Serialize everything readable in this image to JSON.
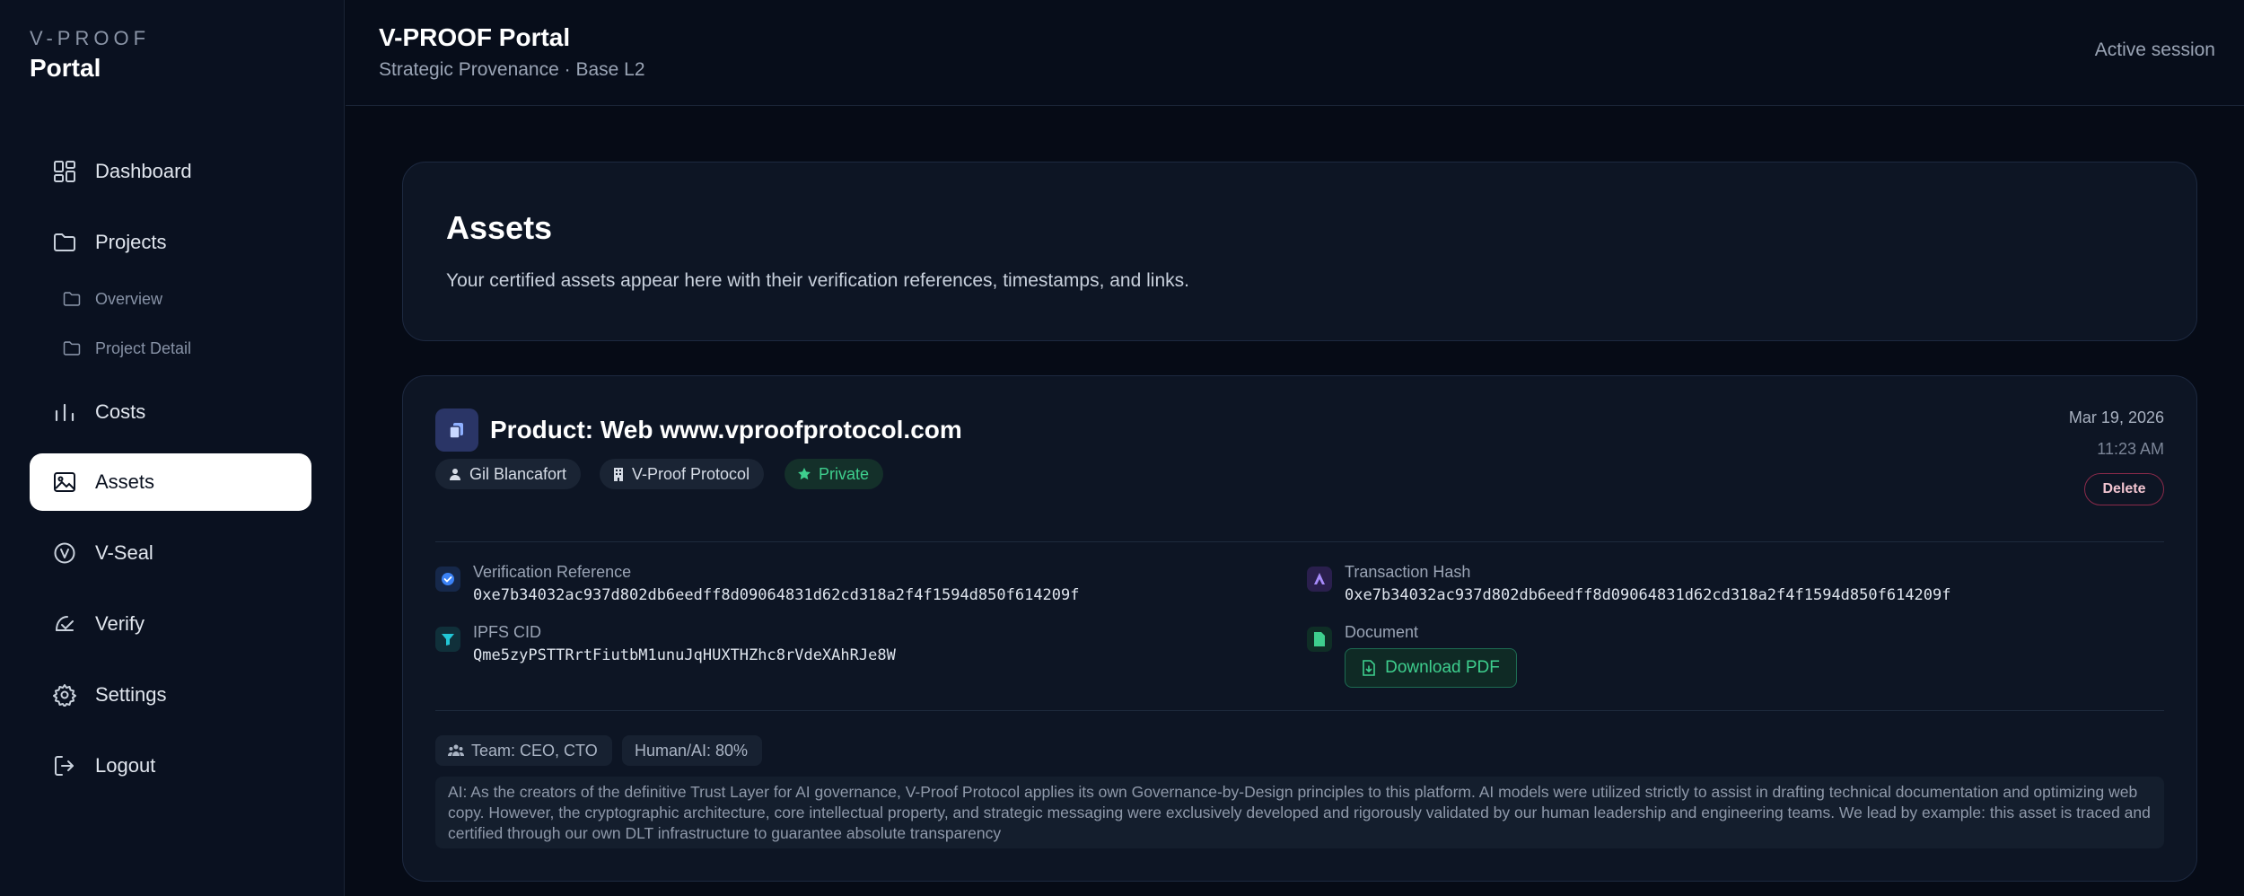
{
  "brand": {
    "small": "V-PROOF",
    "big": "Portal"
  },
  "nav": {
    "dashboard": "Dashboard",
    "projects": "Projects",
    "overview": "Overview",
    "project_detail": "Project Detail",
    "costs": "Costs",
    "assets": "Assets",
    "vseal": "V-Seal",
    "verify": "Verify",
    "settings": "Settings",
    "logout": "Logout"
  },
  "header": {
    "title": "V-PROOF Portal",
    "subtitle": "Strategic Provenance · Base L2",
    "session": "Active session"
  },
  "assets_section": {
    "title": "Assets",
    "description": "Your certified assets appear here with their verification references, timestamps, and links."
  },
  "asset": {
    "title": "Product: Web www.vproofprotocol.com",
    "owner": "Gil Blancafort",
    "organization": "V-Proof Protocol",
    "visibility": "Private",
    "date": "Mar 19, 2026",
    "time": "11:23 AM",
    "delete_label": "Delete",
    "verification_label": "Verification Reference",
    "verification_value": "0xe7b34032ac937d802db6eedff8d09064831d62cd318a2f4f1594d850f614209f",
    "tx_label": "Transaction Hash",
    "tx_value": "0xe7b34032ac937d802db6eedff8d09064831d62cd318a2f4f1594d850f614209f",
    "ipfs_label": "IPFS CID",
    "ipfs_value": "Qme5zyPSTTRrtFiutbM1unuJqHUXTHZhc8rVdeXAhRJe8W",
    "document_label": "Document",
    "download_label": "Download PDF",
    "team": "Team: CEO, CTO",
    "human_ai": "Human/AI: 80%",
    "ai_note": "AI: As the creators of the definitive Trust Layer for AI governance, V-Proof Protocol applies its own Governance-by-Design principles to this platform. AI models were utilized strictly to assist in drafting technical documentation and optimizing web copy. However, the cryptographic architecture, core intellectual property, and strategic messaging were exclusively developed and rigorously validated by our human leadership and engineering teams. We lead by example: this asset is traced and certified through our own DLT infrastructure to guarantee absolute transparency"
  },
  "colors": {
    "background": "#060b16",
    "sidebar": "#0a1120",
    "accent_green": "#3ecf8e",
    "danger": "#8a2a4a",
    "verify_blue": "#3b82f6",
    "tx_purple": "#8b5cf6",
    "ipfs_teal": "#22c7d6"
  }
}
